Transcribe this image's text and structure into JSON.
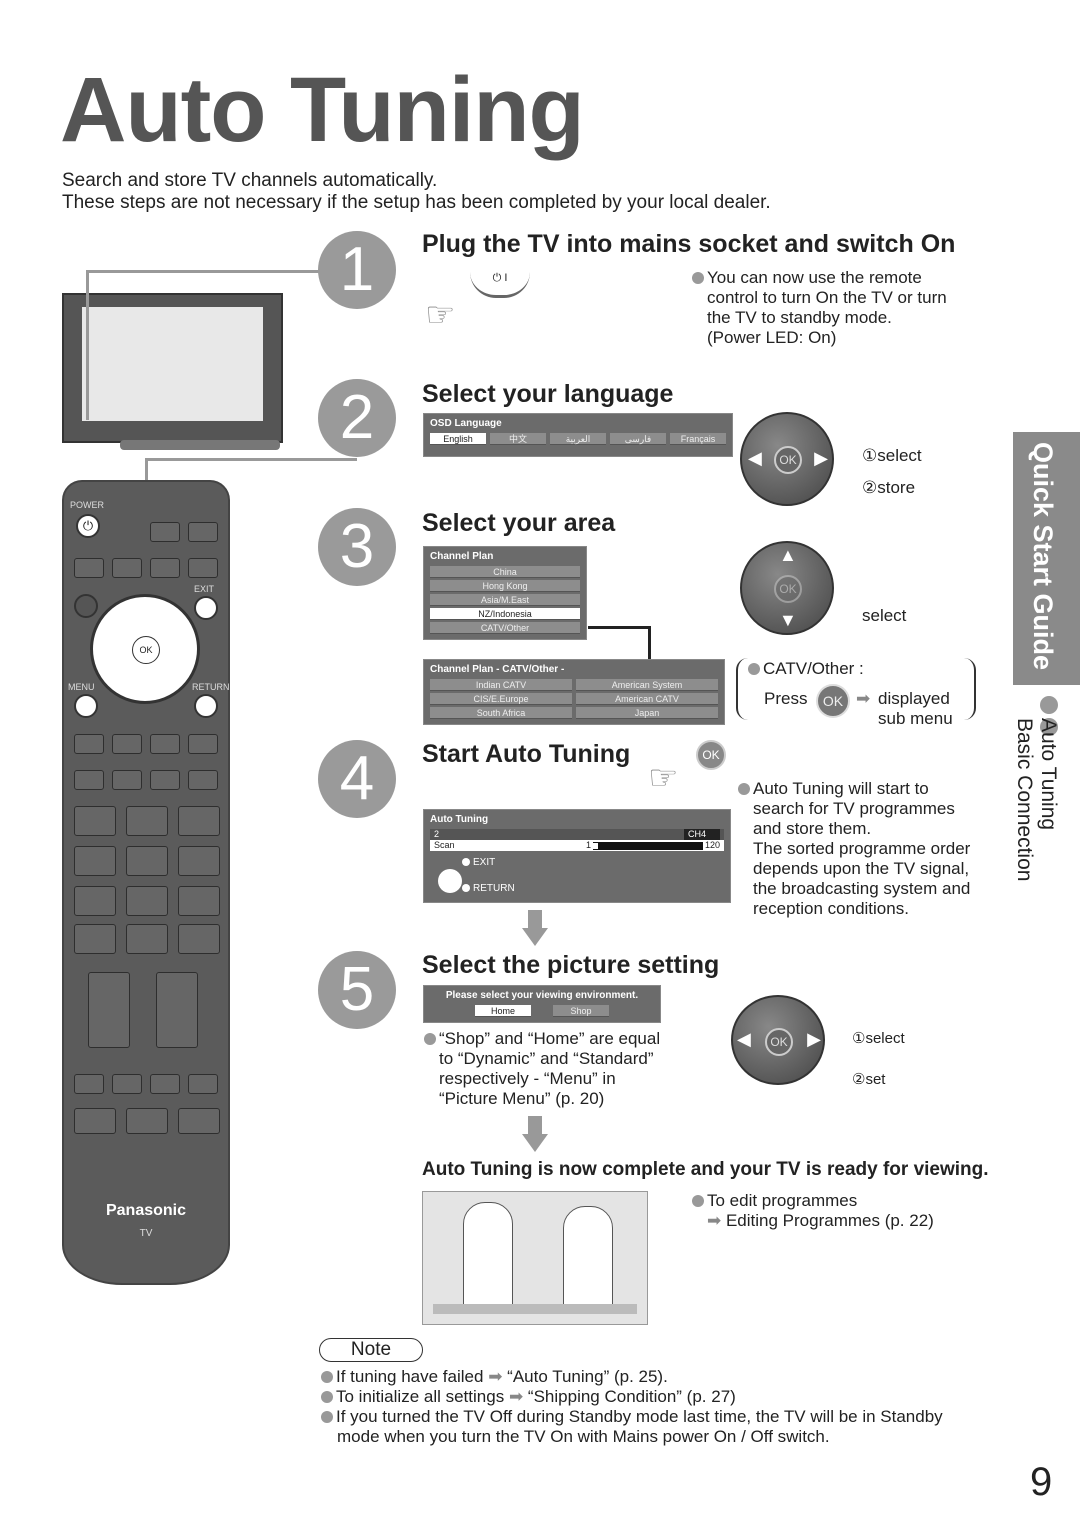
{
  "title": "Auto Tuning",
  "intro": [
    "Search and store TV channels automatically.",
    "These steps are not necessary if the setup has been completed by your local dealer."
  ],
  "steps": [
    {
      "num": "1",
      "heading": "Plug the TV into mains socket and switch On",
      "power_symbol": "⏻ I",
      "notes": [
        "You can now use the remote",
        "control to turn On the TV or turn",
        "the TV to standby mode.",
        "(Power LED: On)"
      ]
    },
    {
      "num": "2",
      "heading": "Select your language",
      "osd_title": "OSD Language",
      "options": [
        "English",
        "中文",
        "العربية",
        "فارسی",
        "Français"
      ],
      "selected": "English",
      "select_label": "①select",
      "store_label": "②store"
    },
    {
      "num": "3",
      "heading": "Select your area",
      "osd_title": "Channel Plan",
      "options": [
        "China",
        "Hong Kong",
        "Asia/M.East",
        "NZ/Indonesia",
        "CATV/Other"
      ],
      "selected": "NZ/Indonesia",
      "sub_title": "Channel Plan - CATV/Other -",
      "sub_options": [
        "Indian CATV",
        "American System",
        "CIS/E.Europe",
        "American CATV",
        "South Africa",
        "Japan"
      ],
      "select_label": "select",
      "catv_note": "CATV/Other :",
      "press": "Press",
      "displayed": "displayed",
      "sub_menu": "sub menu"
    },
    {
      "num": "4",
      "heading": "Start Auto Tuning",
      "osd_title": "Auto Tuning",
      "row1_left": "2",
      "row1_right": "CH4",
      "scan": "Scan",
      "scan_start": "1",
      "scan_end": "120",
      "scan_progress": 0.01,
      "exit": "EXIT",
      "return": "RETURN",
      "notes": [
        "Auto Tuning will start to",
        "search for TV programmes",
        "and store them.",
        "The sorted programme order",
        "depends upon the TV signal,",
        "the broadcasting system and",
        "reception conditions."
      ]
    },
    {
      "num": "5",
      "heading": "Select the picture setting",
      "osd_title": "Please select your viewing environment.",
      "options": [
        "Home",
        "Shop"
      ],
      "selected": "Home",
      "notes": [
        "“Shop” and “Home” are equal",
        "to “Dynamic” and “Standard”",
        "respectively - “Menu” in",
        "“Picture Menu” (p. 20)"
      ],
      "select_label": "①select",
      "set_label": "②set"
    }
  ],
  "ok": "OK",
  "complete": "Auto Tuning is now complete and your TV is ready for viewing.",
  "edit": {
    "line1": "To edit programmes",
    "line2": "Editing Programmes (p. 22)"
  },
  "note": {
    "label": "Note",
    "items": [
      {
        "a": "If tuning have failed",
        "b": "“Auto Tuning” (p. 25)."
      },
      {
        "a": "To initialize all settings",
        "b": "“Shipping Condition” (p. 27)"
      },
      {
        "a": "If you turned the TV Off during Standby mode last time, the TV will be in Standby",
        "b": "mode when you turn the TV On with Mains power On / Off switch."
      }
    ]
  },
  "side_tab": "Quick Start Guide",
  "side_sub": [
    "Auto Tuning",
    "Basic Connection"
  ],
  "remote": {
    "power": "POWER",
    "exit": "EXIT",
    "menu": "MENU",
    "return": "RETURN",
    "brand": "Panasonic",
    "tv": "TV"
  },
  "page_number": "9"
}
